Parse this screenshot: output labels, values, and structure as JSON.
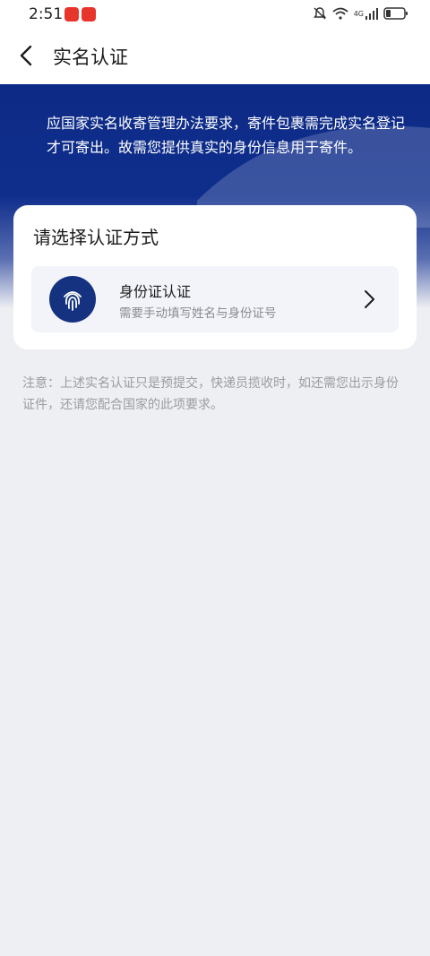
{
  "status_bar": {
    "time": "2:51",
    "network_label": "4G"
  },
  "header": {
    "title": "实名认证"
  },
  "banner": {
    "text": "应国家实名收寄管理办法要求，寄件包裹需完成实名登记才可寄出。故需您提供真实的身份信息用于寄件。"
  },
  "card": {
    "title": "请选择认证方式",
    "option": {
      "title": "身份证认证",
      "subtitle": "需要手动填写姓名与身份证号",
      "icon": "fingerprint-icon"
    }
  },
  "notice": {
    "text": "注意：上述实名认证只是预提交，快递员揽收时，如还需您出示身份证件，还请您配合国家的此项要求。"
  },
  "colors": {
    "banner_blue": "#0f2e8c",
    "icon_blue": "#14327f",
    "background": "#eeeff3"
  }
}
